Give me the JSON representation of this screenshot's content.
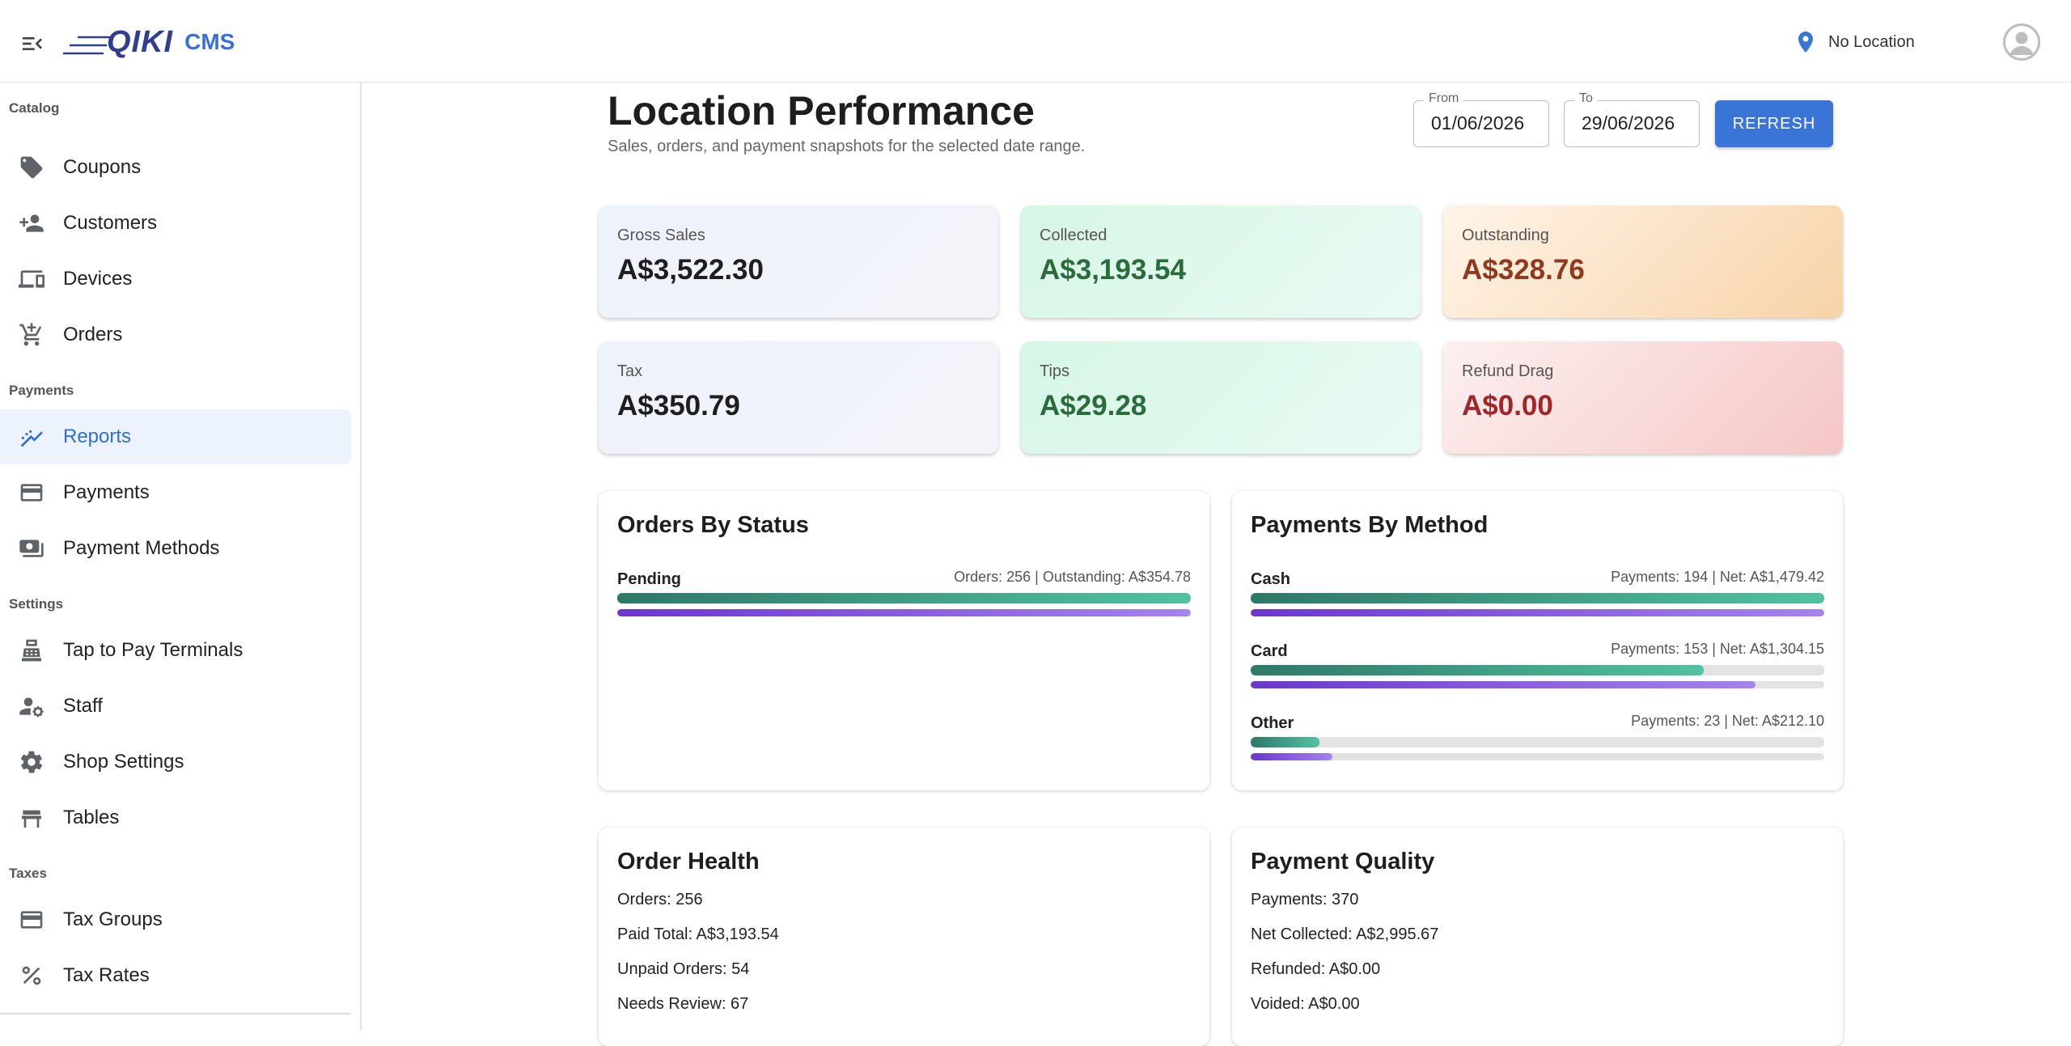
{
  "app": {
    "logo_text": "QIKI",
    "cms_label": "CMS",
    "location_label": "No Location"
  },
  "sidebar": {
    "sections": [
      {
        "title": "Catalog"
      },
      {
        "title": "Payments"
      },
      {
        "title": "Settings"
      },
      {
        "title": "Taxes"
      }
    ],
    "items": [
      {
        "label": "Coupons",
        "icon": "tag-icon"
      },
      {
        "label": "Customers",
        "icon": "person-add-icon"
      },
      {
        "label": "Devices",
        "icon": "devices-icon"
      },
      {
        "label": "Orders",
        "icon": "cart-icon"
      },
      {
        "label": "Reports",
        "icon": "trending-icon",
        "active": true
      },
      {
        "label": "Payments",
        "icon": "credit-card-icon"
      },
      {
        "label": "Payment Methods",
        "icon": "payments-icon"
      },
      {
        "label": "Tap to Pay Terminals",
        "icon": "terminal-icon"
      },
      {
        "label": "Staff",
        "icon": "staff-icon"
      },
      {
        "label": "Shop Settings",
        "icon": "gear-icon"
      },
      {
        "label": "Tables",
        "icon": "table-icon"
      },
      {
        "label": "Tax Groups",
        "icon": "credit-card-icon"
      },
      {
        "label": "Tax Rates",
        "icon": "percent-icon"
      }
    ]
  },
  "page": {
    "title": "Location Performance",
    "subtitle": "Sales, orders, and payment snapshots for the selected date range.",
    "from_label": "From",
    "from_value": "01/06/2026",
    "to_label": "To",
    "to_value": "29/06/2026",
    "refresh_label": "REFRESH"
  },
  "stats": [
    {
      "label": "Gross Sales",
      "value": "A$3,522.30",
      "value_color": "#1e1e1e"
    },
    {
      "label": "Collected",
      "value": "A$3,193.54",
      "value_color": "#2b6b3c"
    },
    {
      "label": "Outstanding",
      "value": "A$328.76",
      "value_color": "#8f3a1e"
    },
    {
      "label": "Tax",
      "value": "A$350.79",
      "value_color": "#1e1e1e"
    },
    {
      "label": "Tips",
      "value": "A$29.28",
      "value_color": "#2b6b3c"
    },
    {
      "label": "Refund Drag",
      "value": "A$0.00",
      "value_color": "#a0262a"
    }
  ],
  "orders_by_status": {
    "title": "Orders By Status",
    "rows": [
      {
        "name": "Pending",
        "meta": "Orders: 256 | Outstanding: A$354.78",
        "primary_fraction": 1.0,
        "secondary_fraction": 1.0
      }
    ]
  },
  "payments_by_method": {
    "title": "Payments By Method",
    "rows": [
      {
        "name": "Cash",
        "meta": "Payments: 194 | Net: A$1,479.42",
        "primary_fraction": 1.0,
        "secondary_fraction": 1.0
      },
      {
        "name": "Card",
        "meta": "Payments: 153 | Net: A$1,304.15",
        "primary_fraction": 0.79,
        "secondary_fraction": 0.88
      },
      {
        "name": "Other",
        "meta": "Payments: 23 | Net: A$212.10",
        "primary_fraction": 0.12,
        "secondary_fraction": 0.143
      }
    ]
  },
  "order_health": {
    "title": "Order Health",
    "lines": [
      "Orders: 256",
      "Paid Total: A$3,193.54",
      "Unpaid Orders: 54",
      "Needs Review: 67"
    ]
  },
  "payment_quality": {
    "title": "Payment Quality",
    "lines": [
      "Payments: 370",
      "Net Collected: A$2,995.67",
      "Refunded: A$0.00",
      "Voided: A$0.00"
    ]
  }
}
